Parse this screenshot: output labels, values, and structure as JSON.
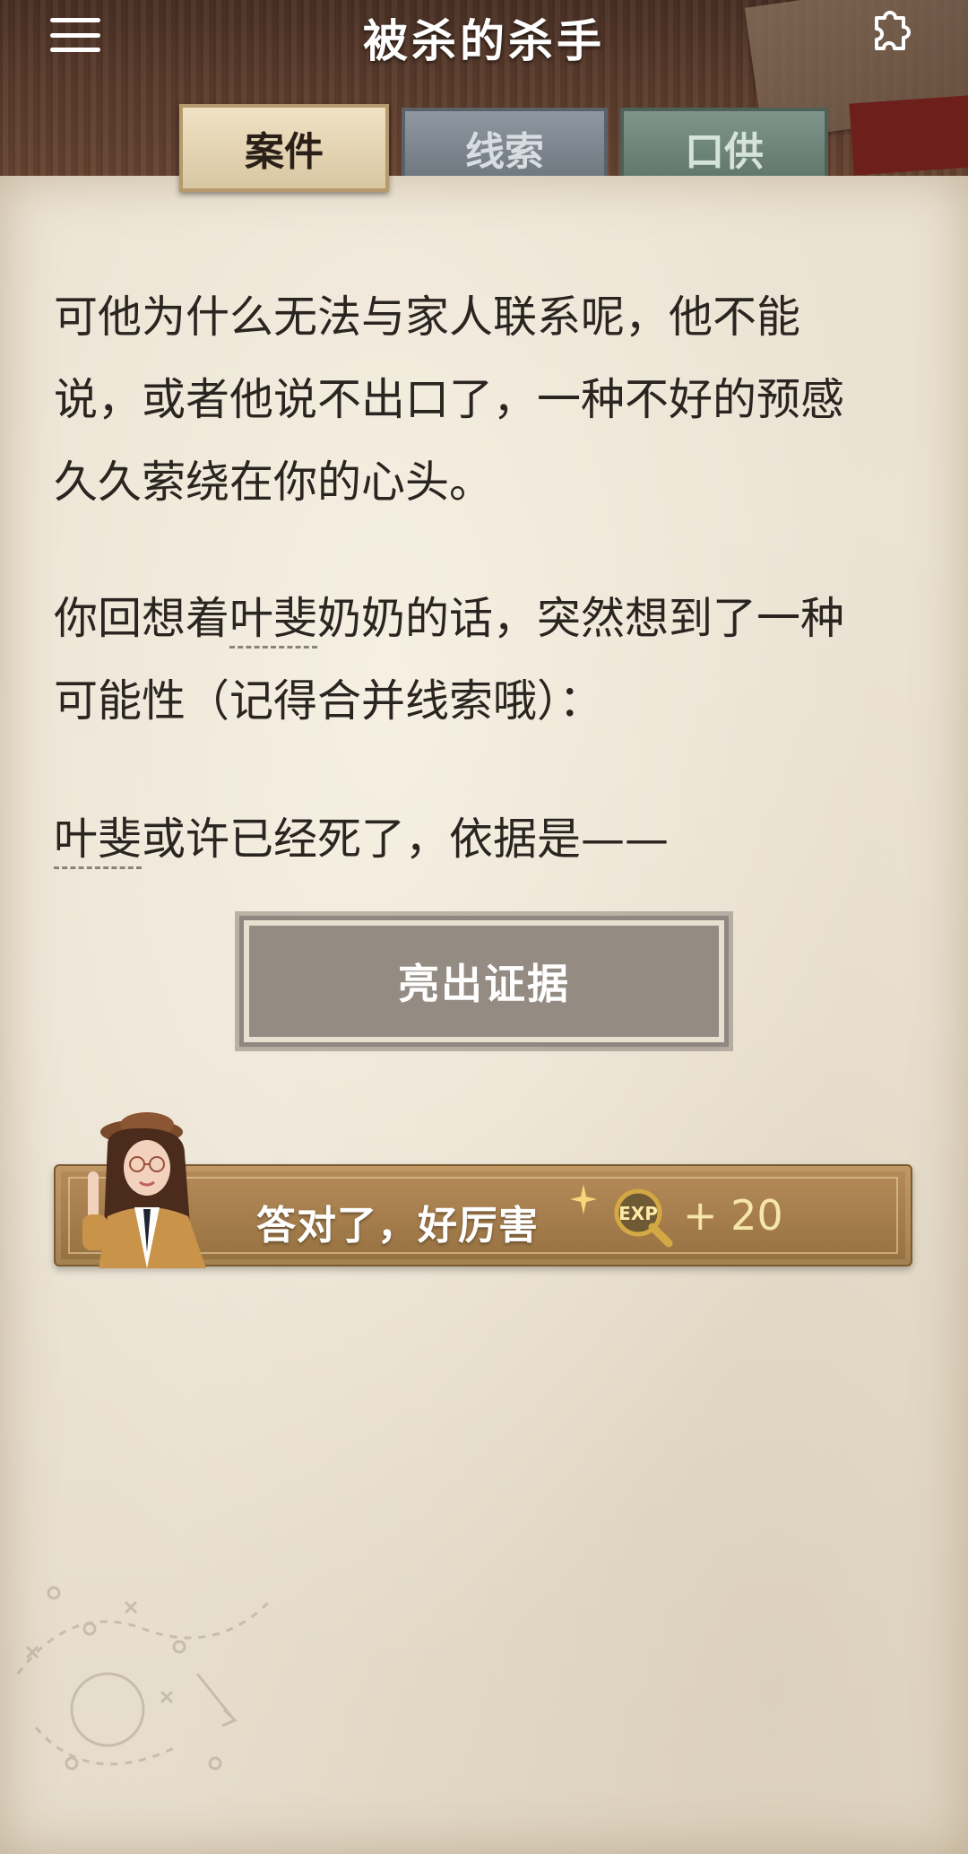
{
  "header": {
    "title": "被杀的杀手"
  },
  "tabs": [
    {
      "label": "案件",
      "active": true
    },
    {
      "label": "线索",
      "active": false
    },
    {
      "label": "口供",
      "active": false
    }
  ],
  "story": {
    "p1": "可他为什么无法与家人联系呢，他不能说，或者他说不出口了，一种不好的预感久久萦绕在你的心头。",
    "p2_before": "你回想着",
    "p2_keyword": "叶斐",
    "p2_after": "奶奶的话，突然想到了一种可能性（记得合并线索哦）：",
    "p3_keyword": "叶斐",
    "p3_after": "或许已经死了，依据是——"
  },
  "evidence_button": {
    "label": "亮出证据"
  },
  "result": {
    "text": "答对了，好厉害",
    "exp_label": "EXP",
    "exp_value": "+ 20"
  },
  "colors": {
    "paper": "#ece4d5",
    "button": "#948b83",
    "banner": "#a57d4d",
    "exp_text": "#f7e6a9"
  },
  "icons": [
    "menu-icon",
    "puzzle-icon",
    "sparkle-icon",
    "exp-icon",
    "avatar"
  ]
}
